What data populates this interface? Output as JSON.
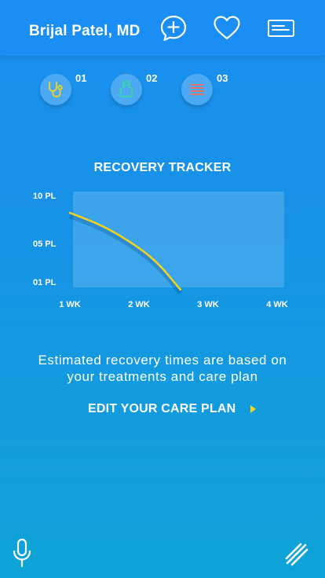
{
  "header": {
    "doctor_name": "Brijal Patel, MD",
    "icons": [
      "add-chat-icon",
      "heart-icon",
      "card-icon"
    ]
  },
  "treatments": [
    {
      "number": "01",
      "icon": "stethoscope-icon",
      "color": "#f5d31d"
    },
    {
      "number": "02",
      "icon": "medicine-bottle-icon",
      "color": "#36d6a6"
    },
    {
      "number": "03",
      "icon": "list-icon",
      "color": "#ef6a5a"
    }
  ],
  "tracker": {
    "title": "RECOVERY TRACKER"
  },
  "chart_data": {
    "type": "line",
    "title": "RECOVERY TRACKER",
    "x_ticks": [
      "1 WK",
      "2 WK",
      "3 WK",
      "4 WK"
    ],
    "y_ticks": [
      "10 PL",
      "05 PL",
      "01 PL"
    ],
    "ylim": [
      1,
      10
    ],
    "series": [
      {
        "x": [
          1.0,
          1.5,
          2.0,
          2.3,
          2.6
        ],
        "y": [
          8.2,
          6.8,
          4.6,
          2.8,
          0.2
        ],
        "color": "#f5d31d"
      }
    ],
    "grid": false
  },
  "description": "Estimated recovery times are based on your treatments and care plan",
  "edit_plan": {
    "label": "EDIT YOUR CARE PLAN",
    "arrow_color": "#f5d31d"
  },
  "footer": {
    "icons": [
      "microphone-icon",
      "menu-icon"
    ]
  }
}
